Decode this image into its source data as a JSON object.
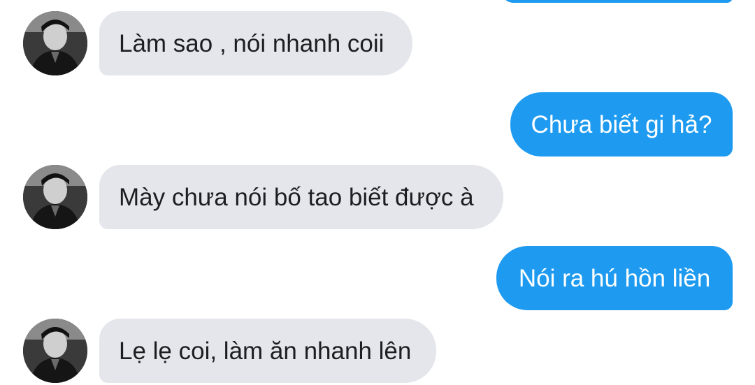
{
  "conversation": {
    "messages": [
      {
        "side": "incoming",
        "text": "Làm sao , nói nhanh coii"
      },
      {
        "side": "outgoing",
        "text": "Chưa biết gi hả?"
      },
      {
        "side": "incoming",
        "text": "Mày chưa nói bố tao biết được à"
      },
      {
        "side": "outgoing",
        "text": "Nói ra hú hồn liền"
      },
      {
        "side": "incoming",
        "text": "Lẹ lẹ coi, làm ăn nhanh lên"
      }
    ]
  },
  "colors": {
    "outgoing_bubble": "#1e9bf0",
    "incoming_bubble": "#e4e6eb",
    "incoming_text": "#1c1e21",
    "outgoing_text": "#ffffff",
    "background": "#ffffff"
  },
  "icons": {
    "avatar": "contact-avatar-photo"
  }
}
